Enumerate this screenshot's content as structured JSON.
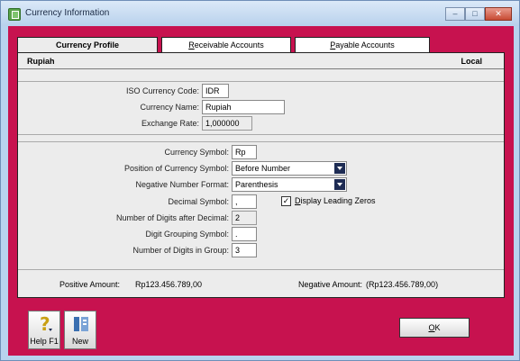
{
  "window": {
    "title": "Currency Information"
  },
  "tabs": [
    {
      "label": "Currency Profile",
      "accel": "",
      "rest": ""
    },
    {
      "label": "Receivable Accounts",
      "accel": "R",
      "rest": "eceivable Accounts"
    },
    {
      "label": "Payable Accounts",
      "accel": "P",
      "rest": "ayable Accounts"
    }
  ],
  "header": {
    "currency_name": "Rupiah",
    "type": "Local"
  },
  "profile": {
    "iso_label": "ISO Currency Code:",
    "iso_value": "IDR",
    "name_label": "Currency Name:",
    "name_value": "Rupiah",
    "rate_label": "Exchange Rate:",
    "rate_value": "1,000000"
  },
  "format": {
    "symbol_label": "Currency Symbol:",
    "symbol_value": "Rp",
    "position_label": "Position of Currency Symbol:",
    "position_value": "Before Number",
    "negative_label": "Negative Number Format:",
    "negative_value": "Parenthesis",
    "decimal_label": "Decimal Symbol:",
    "decimal_value": ",",
    "leading_zeros_label": "Display Leading Zeros",
    "leading_zeros_accel": "D",
    "leading_zeros_rest": "isplay Leading Zeros",
    "leading_zeros_checked": true,
    "digits_after_label": "Number of Digits after Decimal:",
    "digits_after_value": "2",
    "grouping_label": "Digit Grouping Symbol:",
    "grouping_value": ".",
    "group_digits_label": "Number of Digits in Group:",
    "group_digits_value": "3"
  },
  "preview": {
    "positive_label": "Positive Amount:",
    "positive_value": "Rp123.456.789,00",
    "negative_label": "Negative Amount:",
    "negative_value": "(Rp123.456.789,00)"
  },
  "buttons": {
    "help_label": "Help F1",
    "new_label": "New",
    "ok_accel": "O",
    "ok_rest": "K"
  },
  "colors": {
    "background_accent": "#c7124f",
    "panel": "#ececec"
  }
}
